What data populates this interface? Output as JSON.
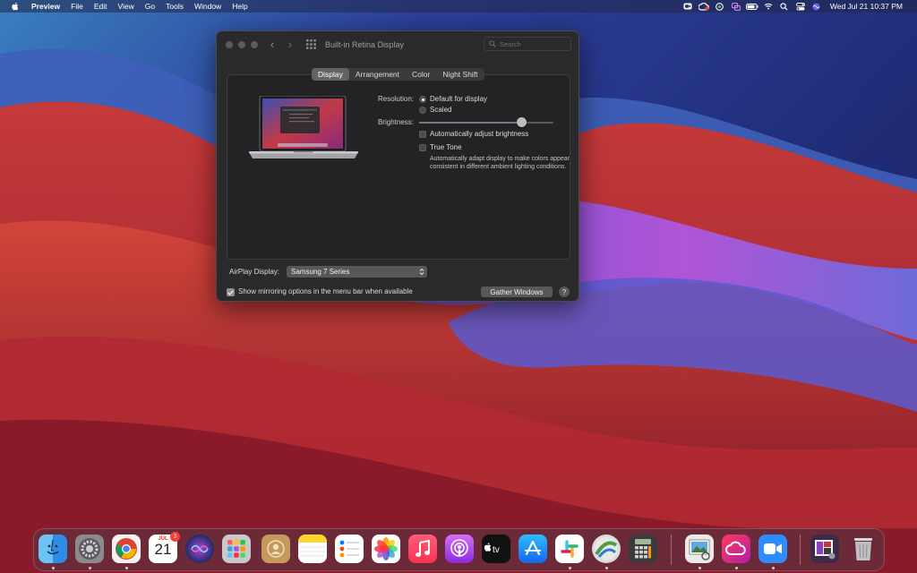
{
  "menubar": {
    "app_name": "Preview",
    "menus": [
      "File",
      "Edit",
      "View",
      "Go",
      "Tools",
      "Window",
      "Help"
    ],
    "clock": "Wed Jul 21  10:37 PM",
    "status_icons": [
      "zoom-icon",
      "creative-cloud-icon",
      "vpn-icon",
      "screen-mirror-icon",
      "battery-icon",
      "wifi-icon",
      "search-icon",
      "control-center-icon",
      "siri-icon"
    ]
  },
  "window": {
    "title": "Built-in Retina Display",
    "search_placeholder": "Search",
    "tabs": [
      "Display",
      "Arrangement",
      "Color",
      "Night Shift"
    ],
    "active_tab": "Display",
    "resolution_label": "Resolution:",
    "resolution_options": [
      "Default for display",
      "Scaled"
    ],
    "resolution_selected": "Default for display",
    "brightness_label": "Brightness:",
    "brightness_level": 0.76,
    "auto_brightness_label": "Automatically adjust brightness",
    "auto_brightness_checked": false,
    "true_tone_label": "True Tone",
    "true_tone_checked": false,
    "true_tone_description": "Automatically adapt display to make colors appear consistent in different ambient lighting conditions.",
    "airplay_label": "AirPlay Display:",
    "airplay_value": "Samsung 7 Series",
    "mirroring_label": "Show mirroring options in the menu bar when available",
    "mirroring_checked": true,
    "gather_button": "Gather Windows",
    "help_button": "?"
  },
  "dock": {
    "calendar_month": "JUL",
    "calendar_day": "21",
    "calendar_badge": "3",
    "apps": [
      "Finder",
      "System Preferences",
      "Google Chrome",
      "Calendar",
      "Siri",
      "Launchpad",
      "Contacts",
      "Notes",
      "Reminders",
      "Photos",
      "Music",
      "Podcasts",
      "TV",
      "App Store",
      "Slack",
      "Network Radar",
      "Calculator",
      "Preview",
      "Creative Cloud",
      "Zoom",
      "Downloads",
      "Trash"
    ]
  }
}
